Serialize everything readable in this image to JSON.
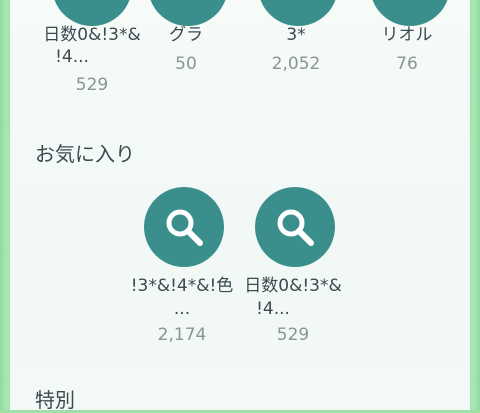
{
  "recent": {
    "items": [
      {
        "label_line1": "日数0&!3*&",
        "label_line2": "!4...",
        "count": "529"
      },
      {
        "label_line1": "グラ",
        "label_line2": "",
        "count": "50"
      },
      {
        "label_line1": "3*",
        "label_line2": "",
        "count": "2,052"
      },
      {
        "label_line1": "リオル",
        "label_line2": "",
        "count": "76"
      }
    ]
  },
  "favorites": {
    "title": "お気に入り",
    "items": [
      {
        "icon": "search-icon",
        "label_line1": "!3*&!4*&!色",
        "label_line2": "...",
        "count": "2,174"
      },
      {
        "icon": "search-icon",
        "label_line1": "日数0&!3*&",
        "label_line2": "!4...",
        "count": "529"
      }
    ]
  },
  "special": {
    "title": "特別"
  },
  "colors": {
    "accent": "#3a8f8c",
    "text": "#3b4a4f",
    "muted": "#8a9498",
    "edge": "#9fe0a8"
  }
}
